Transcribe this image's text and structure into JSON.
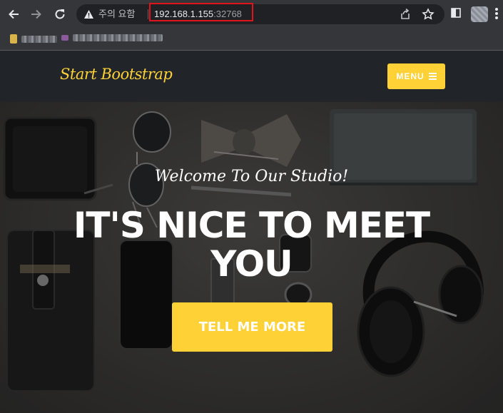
{
  "browser": {
    "security_label": "주의 요함",
    "url_host": "192.168.1.155",
    "url_port": ":32768"
  },
  "navbar": {
    "brand": "Start Bootstrap",
    "menu_label": "MENU"
  },
  "hero": {
    "subheading": "Welcome To Our Studio!",
    "heading": "IT'S NICE TO MEET YOU",
    "cta_label": "TELL ME MORE"
  },
  "colors": {
    "accent": "#fed136",
    "navbar_bg": "#212529",
    "chrome_bg": "#35363a",
    "url_highlight": "#e3131b"
  }
}
